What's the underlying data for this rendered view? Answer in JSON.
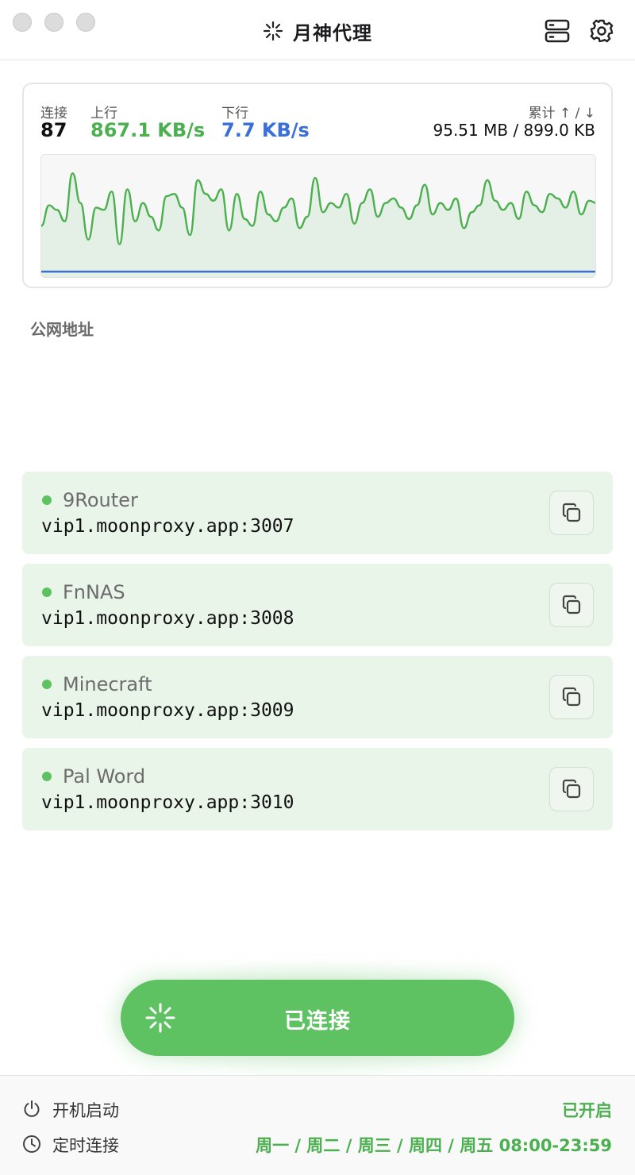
{
  "app": {
    "title": "月神代理"
  },
  "stats": {
    "connections_label": "连接",
    "connections_value": "87",
    "upload_label": "上行",
    "upload_value": "867.1 KB/s",
    "download_label": "下行",
    "download_value": "7.7 KB/s",
    "total_label": "累计 ↑ / ↓",
    "total_value": "95.51 MB / 899.0 KB"
  },
  "colors": {
    "accent_green": "#5ec162",
    "upload_green": "#4caf50",
    "download_blue": "#3a6fd8",
    "row_background": "#eaf5ea"
  },
  "chart_data": {
    "type": "area",
    "series": [
      {
        "values": [
          0.42,
          0.6,
          0.56,
          0.46,
          0.88,
          0.62,
          0.3,
          0.58,
          0.56,
          0.72,
          0.26,
          0.74,
          0.46,
          0.62,
          0.5,
          0.38,
          0.68,
          0.7,
          0.58,
          0.34,
          0.82,
          0.7,
          0.64,
          0.74,
          0.38,
          0.7,
          0.48,
          0.42,
          0.72,
          0.52,
          0.46,
          0.58,
          0.66,
          0.4,
          0.5,
          0.84,
          0.54,
          0.62,
          0.58,
          0.7,
          0.44,
          0.62,
          0.74,
          0.5,
          0.62,
          0.66,
          0.58,
          0.48,
          0.6,
          0.78,
          0.52,
          0.62,
          0.56,
          0.66,
          0.4,
          0.54,
          0.6,
          0.82,
          0.64,
          0.56,
          0.62,
          0.48,
          0.72,
          0.6,
          0.54,
          0.7,
          0.66,
          0.58,
          0.72,
          0.52,
          0.64,
          0.62
        ]
      },
      {
        "values": [
          0.02,
          0.02,
          0.02,
          0.02,
          0.02,
          0.02,
          0.02,
          0.02,
          0.02,
          0.02,
          0.02,
          0.02,
          0.02,
          0.02,
          0.02,
          0.02,
          0.02,
          0.02,
          0.02,
          0.02
        ]
      }
    ]
  },
  "public_section": {
    "title": "公网地址"
  },
  "services": [
    {
      "name": "9Router",
      "address": "vip1.moonproxy.app:3007",
      "status": "online",
      "copy_icon": "copy-icon"
    },
    {
      "name": "FnNAS",
      "address": "vip1.moonproxy.app:3008",
      "status": "online",
      "copy_icon": "copy-icon"
    },
    {
      "name": "Minecraft",
      "address": "vip1.moonproxy.app:3009",
      "status": "online",
      "copy_icon": "copy-icon"
    },
    {
      "name": "Pal Word",
      "address": "vip1.moonproxy.app:3010",
      "status": "online",
      "copy_icon": "copy-icon"
    }
  ],
  "connect": {
    "label": "已连接",
    "icon": "sparkle-icon"
  },
  "footer": {
    "autostart_label": "开机启动",
    "autostart_value": "已开启",
    "schedule_label": "定时连接",
    "schedule_value": "周一 / 周二 / 周三 / 周四 / 周五 08:00-23:59"
  }
}
